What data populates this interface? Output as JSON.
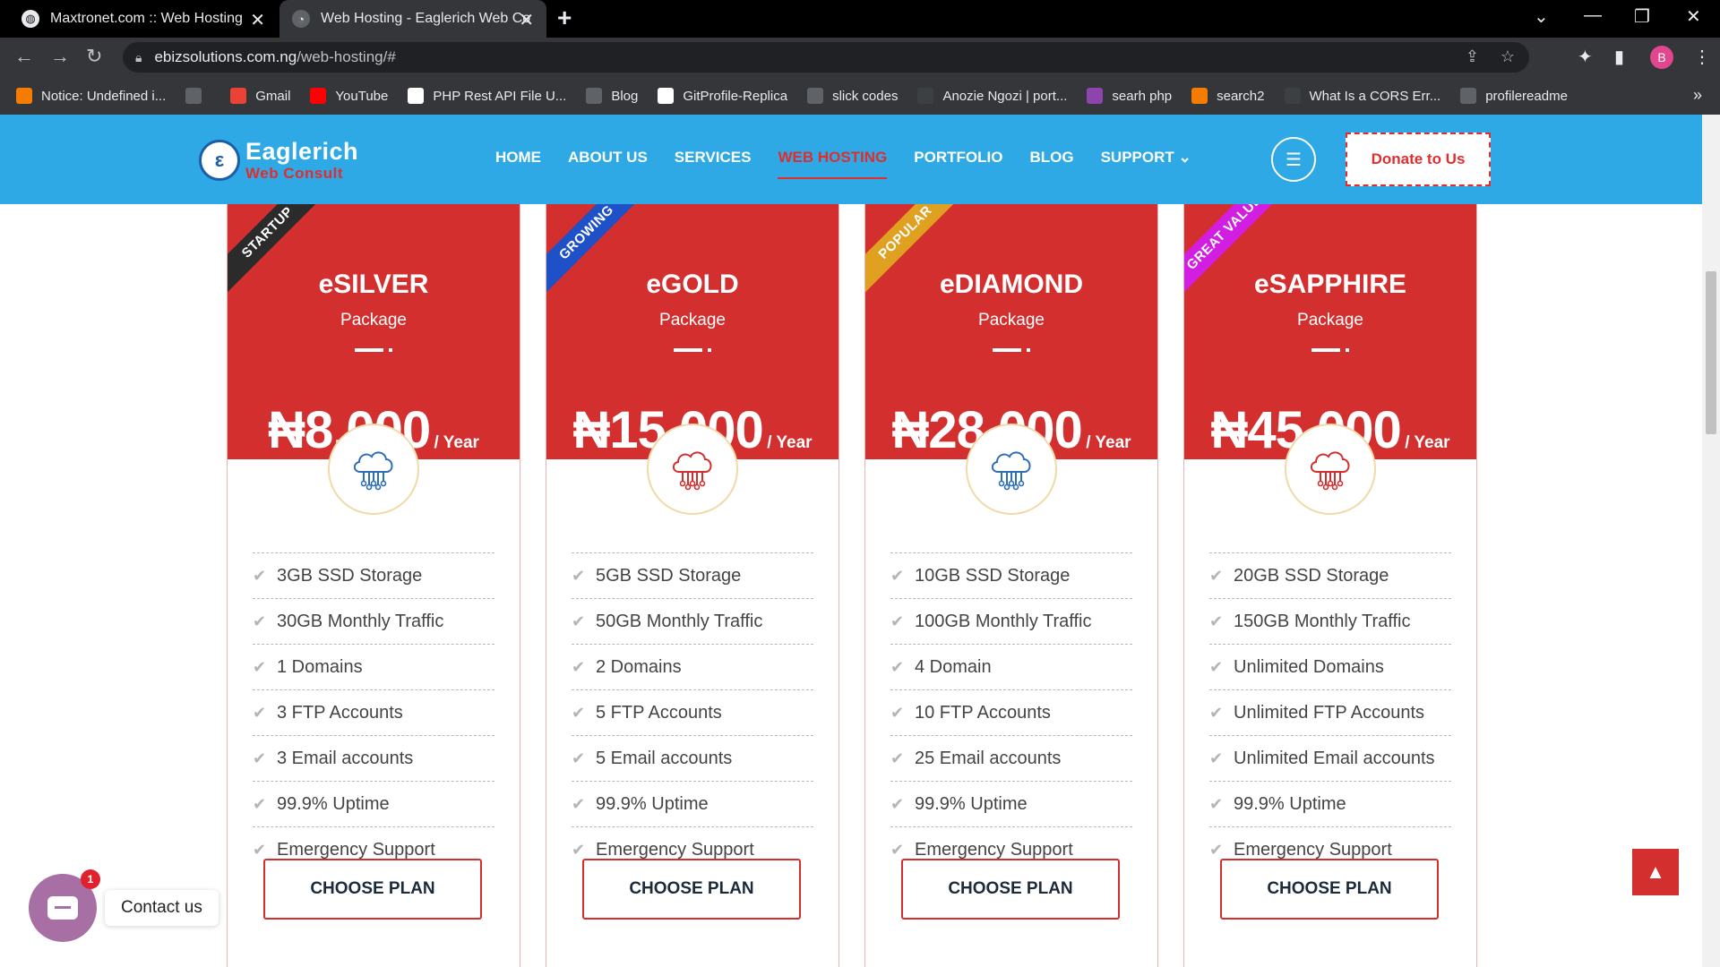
{
  "browser": {
    "tabs": [
      {
        "title": "Maxtronet.com :: Web Hosting",
        "active": false
      },
      {
        "title": "Web Hosting - Eaglerich Web Co",
        "active": true
      }
    ],
    "url": {
      "domain": "ebizsolutions.com.ng",
      "path": "/web-hosting/#"
    },
    "profile_initial": "B",
    "bookmarks": [
      {
        "label": "Notice: Undefined i...",
        "color": "#f57c00"
      },
      {
        "label": "",
        "color": "#5f6368"
      },
      {
        "label": "Gmail",
        "color": "#ea4335"
      },
      {
        "label": "YouTube",
        "color": "#ff0000"
      },
      {
        "label": "PHP Rest API File U...",
        "color": "#ffffff"
      },
      {
        "label": "Blog",
        "color": "#5f6368"
      },
      {
        "label": "GitProfile-Replica",
        "color": "#ffffff"
      },
      {
        "label": "slick codes",
        "color": "#5f6368"
      },
      {
        "label": "Anozie Ngozi | port...",
        "color": "#3c4043"
      },
      {
        "label": "searh php",
        "color": "#8e44ad"
      },
      {
        "label": "search2",
        "color": "#f57c00"
      },
      {
        "label": "What Is a CORS Err...",
        "color": "#3c4043"
      },
      {
        "label": "profilereadme",
        "color": "#5f6368"
      }
    ]
  },
  "header": {
    "logo_line1": "Eaglerich",
    "logo_line2": "Web Consult",
    "nav": [
      {
        "label": "HOME",
        "active": false
      },
      {
        "label": "ABOUT US",
        "active": false
      },
      {
        "label": "SERVICES",
        "active": false
      },
      {
        "label": "WEB HOSTING",
        "active": true
      },
      {
        "label": "PORTFOLIO",
        "active": false
      },
      {
        "label": "BLOG",
        "active": false
      },
      {
        "label": "SUPPORT",
        "active": false
      }
    ],
    "nav_dropdown_icon": "chevron-down-icon",
    "donate_label": "Donate to Us",
    "colors": {
      "header_bg": "#2ea9e6",
      "accent": "#e02e2e"
    }
  },
  "plans": [
    {
      "ribbon": "STARTUP",
      "ribbon_color": "#2b2b2b",
      "name": "eSILVER",
      "subtitle": "Package",
      "price": "₦8,000",
      "period": "/ Year",
      "icon": "cloud-network-icon",
      "icon_color": "#2f6fb5",
      "features": [
        "3GB SSD Storage",
        "30GB Monthly Traffic",
        "1 Domains",
        "3 FTP Accounts",
        "3 Email accounts",
        "99.9% Uptime",
        "Emergency Support"
      ],
      "cta": "CHOOSE PLAN"
    },
    {
      "ribbon": "GROWING",
      "ribbon_color": "#1e50c8",
      "name": "eGOLD",
      "subtitle": "Package",
      "price": "₦15,000",
      "period": "/ Year",
      "icon": "cloud-network-icon",
      "icon_color": "#d32f2f",
      "features": [
        "5GB SSD Storage",
        "50GB Monthly Traffic",
        "2 Domains",
        "5 FTP Accounts",
        "5 Email accounts",
        "99.9% Uptime",
        "Emergency Support"
      ],
      "cta": "CHOOSE PLAN"
    },
    {
      "ribbon": "POPULAR",
      "ribbon_color": "#e0a020",
      "name": "eDIAMOND",
      "subtitle": "Package",
      "price": "₦28,000",
      "period": "/ Year",
      "icon": "cloud-network-icon",
      "icon_color": "#2f6fb5",
      "features": [
        "10GB SSD Storage",
        "100GB Monthly Traffic",
        "4 Domain",
        "10 FTP Accounts",
        "25 Email accounts",
        "99.9% Uptime",
        "Emergency Support"
      ],
      "cta": "CHOOSE PLAN"
    },
    {
      "ribbon": "GREAT VALUE",
      "ribbon_color": "#d21ee0",
      "name": "eSAPPHIRE",
      "subtitle": "Package",
      "price": "₦45,000",
      "period": "/ Year",
      "icon": "cloud-network-icon",
      "icon_color": "#d32f2f",
      "features": [
        "20GB SSD Storage",
        "150GB Monthly Traffic",
        "Unlimited Domains",
        "Unlimited FTP Accounts",
        "Unlimited Email accounts",
        "99.9% Uptime",
        "Emergency Support"
      ],
      "cta": "CHOOSE PLAN"
    }
  ],
  "floating": {
    "contact_label": "Contact us",
    "contact_badge": "1",
    "back_to_top_icon": "chevron-up-icon"
  }
}
